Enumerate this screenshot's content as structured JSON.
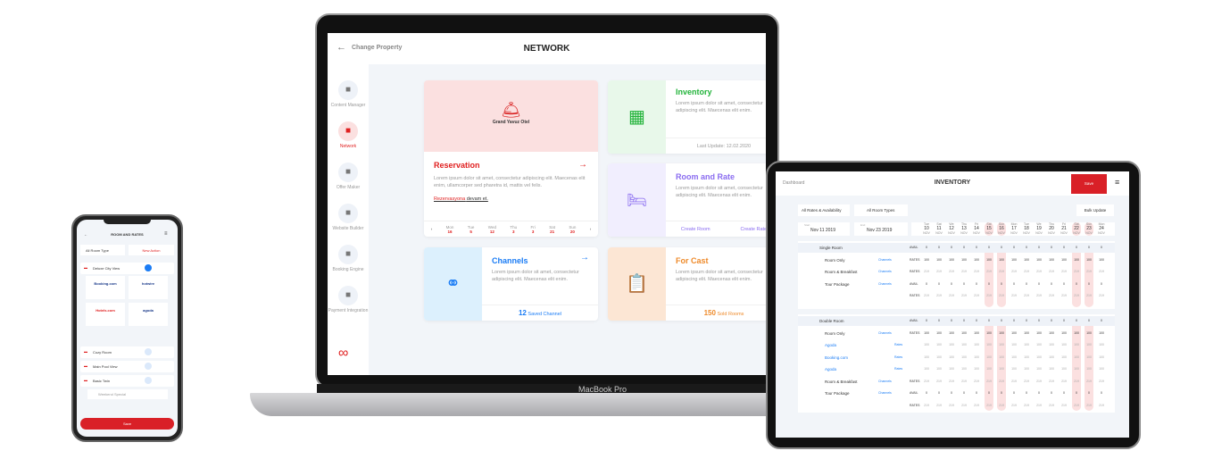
{
  "laptop": {
    "label": "MacBook Pro",
    "header": {
      "back": "Change Property",
      "title": "NETWORK"
    },
    "sidebar": [
      {
        "label": "Content Manager",
        "icon": "building-icon"
      },
      {
        "label": "Network",
        "icon": "network-icon",
        "active": true
      },
      {
        "label": "Offer Maker",
        "icon": "paperclip-icon"
      },
      {
        "label": "Website Builder",
        "icon": "sitemap-icon"
      },
      {
        "label": "Booking Engine",
        "icon": "calendar-icon"
      },
      {
        "label": "Payment Integration",
        "icon": "money-icon"
      }
    ],
    "hotel": "Grand Yavuz Otel",
    "reservation": {
      "title": "Reservation",
      "desc": "Lorem ipsum dolor sit amet, consectetur adipiscing elit. Maecenas elit enim, ullamcorper sed pharetra id, mattis vel felis.",
      "link1": "Rezervasyona",
      "link2": "devam et.",
      "days": [
        {
          "d": "Mon",
          "n": "16"
        },
        {
          "d": "Tue",
          "n": "5"
        },
        {
          "d": "Wed",
          "n": "12"
        },
        {
          "d": "Thu",
          "n": "3"
        },
        {
          "d": "Fri",
          "n": "3"
        },
        {
          "d": "Sat",
          "n": "21"
        },
        {
          "d": "Sun",
          "n": "20"
        }
      ]
    },
    "inventory": {
      "title": "Inventory",
      "desc": "Lorem ipsum dolor sit amet, consectetur adipiscing elit. Maecenas elit enim.",
      "footer": "Last Update: 12.02.2020"
    },
    "roomrate": {
      "title": "Room and Rate",
      "desc": "Lorem ipsum dolor sit amet, consectetur adipiscing elit. Maecenas elit enim.",
      "a1": "Create Room",
      "a2": "Create Rate"
    },
    "channels": {
      "title": "Channels",
      "desc": "Lorem ipsum dolor sit amet, consectetur adipiscing elit. Maecenas elit enim.",
      "count": "12",
      "footer": "Saved Channel"
    },
    "forcast": {
      "title": "For Cast",
      "desc": "Lorem ipsum dolor sit amet, consectetur adipiscing elit. Maecenas elit enim.",
      "count": "150",
      "footer": "Sold Rooms"
    },
    "colors": {
      "red": "#e02020",
      "green": "#22b33a",
      "purple": "#8a6cf0",
      "blue": "#1a7cf5",
      "orange": "#ee8a2a"
    }
  },
  "tablet": {
    "back": "Dashboard",
    "title": "INVENTORY",
    "save": "Save",
    "filter1": "All Rates & Availability",
    "filter2": "All Room Types",
    "bulk": "Bulk Update",
    "start_label": "Start",
    "start": "Nov 11 2019",
    "end_label": "End",
    "end": "Nov 23 2019",
    "dates": [
      [
        "Tue",
        "10"
      ],
      [
        "Sat",
        "11"
      ],
      [
        "We",
        "12"
      ],
      [
        "Thu",
        "13"
      ],
      [
        "Fri",
        "14"
      ],
      [
        "Sat",
        "15"
      ],
      [
        "Sun",
        "16"
      ],
      [
        "Mon",
        "17"
      ],
      [
        "Tue",
        "18"
      ],
      [
        "We",
        "19"
      ],
      [
        "Thu",
        "20"
      ],
      [
        "Fri",
        "21"
      ],
      [
        "Sat",
        "22"
      ],
      [
        "Sun",
        "23"
      ],
      [
        "Mon",
        "24"
      ]
    ],
    "month": "NOV",
    "groups": [
      {
        "rows": [
          [
            "Single Room",
            "",
            "AVAIL",
            "0"
          ],
          [
            "Room Only",
            "Channels",
            "RATES",
            "100"
          ],
          [
            "Room & Breakfast",
            "Channels",
            "RATES",
            "219"
          ],
          [
            "Tour Package",
            "Channels",
            "AVAIL",
            "0"
          ],
          [
            "",
            "",
            "RATES",
            "219"
          ]
        ]
      },
      {
        "rows": [
          [
            "Double Room",
            "",
            "AVAIL",
            "0"
          ],
          [
            "Room Only",
            "Channels",
            "RATES",
            "100"
          ],
          [
            "Agoda",
            "Rates",
            "",
            "100"
          ],
          [
            "Booking.com",
            "Rates",
            "",
            "100"
          ],
          [
            "Agoda",
            "Rates",
            "",
            "100"
          ],
          [
            "Room & Breakfast",
            "Channels",
            "RATES",
            "219"
          ],
          [
            "Tour Package",
            "Channels",
            "AVAIL",
            "0"
          ],
          [
            "",
            "",
            "RATES",
            "219"
          ]
        ]
      }
    ]
  },
  "phone": {
    "title": "ROOM AND RATES",
    "filter": "All Room Type",
    "action": "New Action",
    "rooms": [
      "Deluxe City View",
      "Cozy Room",
      "Main Pool View",
      "Basic Twin"
    ],
    "channels": [
      "Booking.com",
      "hotwire",
      "Hotels.com",
      "agoda"
    ],
    "special": "Weekend Special",
    "save": "Save"
  }
}
